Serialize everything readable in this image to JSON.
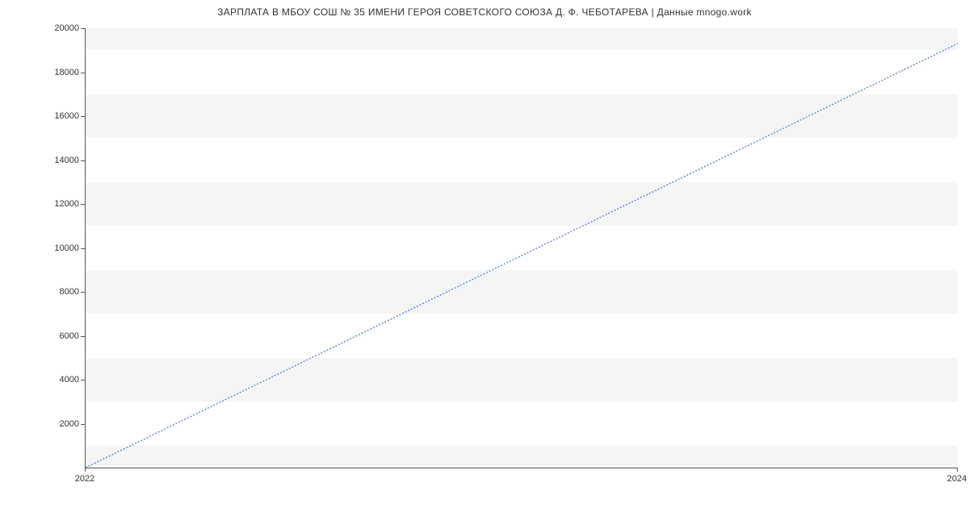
{
  "chart_data": {
    "type": "line",
    "title": "ЗАРПЛАТА В МБОУ СОШ № 35 ИМЕНИ ГЕРОЯ СОВЕТСКОГО СОЮЗА Д. Ф. ЧЕБОТАРЕВА | Данные mnogo.work",
    "x": [
      2022,
      2024
    ],
    "values": [
      0,
      19300
    ],
    "xlabel": "",
    "ylabel": "",
    "xlim": [
      2022,
      2024
    ],
    "ylim": [
      0,
      20000
    ],
    "x_ticks": [
      2022,
      2024
    ],
    "y_ticks": [
      2000,
      4000,
      6000,
      8000,
      10000,
      12000,
      14000,
      16000,
      18000,
      20000
    ],
    "line_color": "#4a7fd6",
    "grid": true
  }
}
